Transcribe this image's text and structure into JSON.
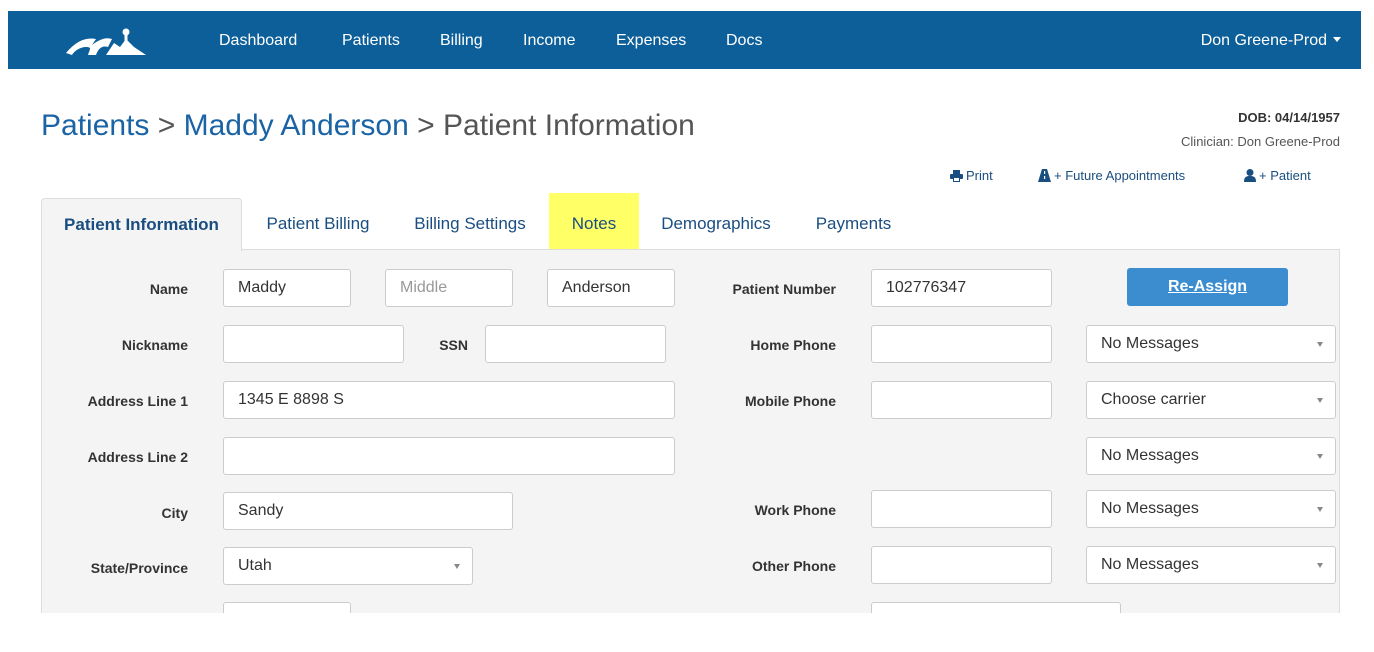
{
  "nav": {
    "items": [
      "Dashboard",
      "Patients",
      "Billing",
      "Income",
      "Expenses",
      "Docs"
    ],
    "user": "Don Greene-Prod"
  },
  "header": {
    "crumb_root": "Patients",
    "crumb_sep": ">",
    "crumb_patient": "Maddy Anderson",
    "crumb_page": "Patient Information",
    "dob": "DOB: 04/14/1957",
    "clinician": "Clinician: Don Greene-Prod"
  },
  "actions": {
    "print": "Print",
    "future_appointments": "+ Future Appointments",
    "patient": "+ Patient"
  },
  "tabs": [
    "Patient Information",
    "Patient Billing",
    "Billing Settings",
    "Notes",
    "Demographics",
    "Payments"
  ],
  "form": {
    "labels": {
      "name": "Name",
      "nickname": "Nickname",
      "ssn": "SSN",
      "address1": "Address Line 1",
      "address2": "Address Line 2",
      "city": "City",
      "state": "State/Province",
      "patient_number": "Patient Number",
      "home_phone": "Home Phone",
      "mobile_phone": "Mobile Phone",
      "work_phone": "Work Phone",
      "other_phone": "Other Phone"
    },
    "values": {
      "first_name": "Maddy",
      "middle_placeholder": "Middle",
      "last_name": "Anderson",
      "address1": "1345 E 8898 S",
      "city": "Sandy",
      "state": "Utah",
      "patient_number": "102776347"
    },
    "reassign": "Re-Assign",
    "selects": {
      "home_msgs": "No Messages",
      "mobile_carrier": "Choose carrier",
      "mobile_msgs": "No Messages",
      "work_msgs": "No Messages",
      "other_msgs": "No Messages"
    }
  }
}
